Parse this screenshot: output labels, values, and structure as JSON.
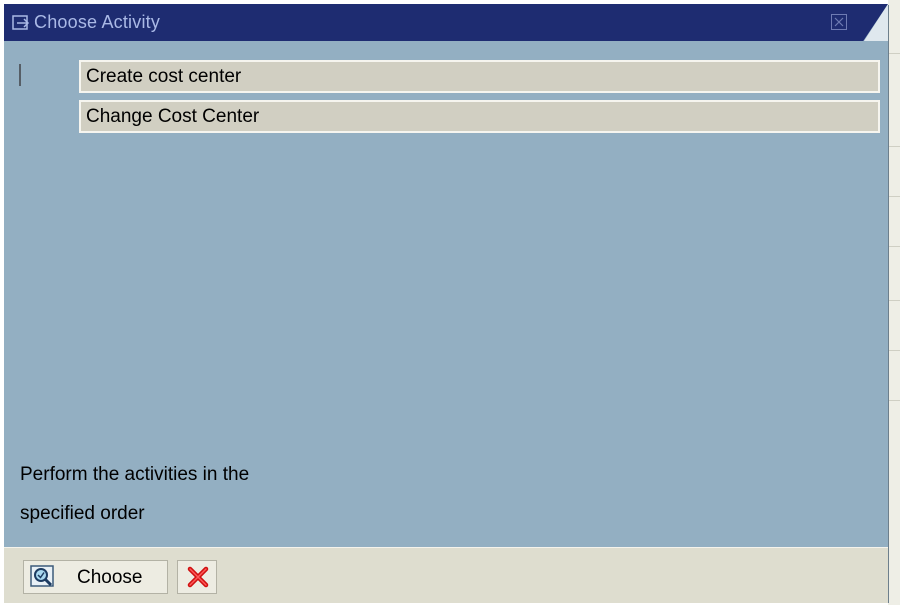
{
  "dialog": {
    "title": "Choose Activity",
    "activities": [
      {
        "label": "Create cost center"
      },
      {
        "label": "Change Cost Center"
      }
    ],
    "instruction_lines": [
      "Perform the activities in the",
      "specified order"
    ]
  },
  "footer": {
    "choose_label": "Choose"
  },
  "colors": {
    "titlebar": "#1e2c71",
    "dialog_bg": "#93afc2",
    "item_bg": "#d1cfc2",
    "footer_bg": "#deddcf"
  },
  "icons": {
    "title": "window-arrow-icon",
    "close": "close-icon",
    "choose": "magnifier-check-icon",
    "cancel": "red-x-icon"
  }
}
